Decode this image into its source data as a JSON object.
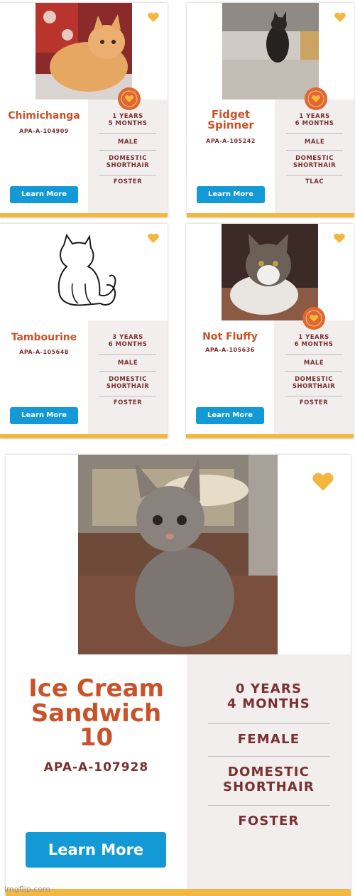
{
  "cats": [
    {
      "name": "Chimichanga",
      "id": "APA-A-104909",
      "age_line1": "1 YEARS",
      "age_line2": "5 MONTHS",
      "sex": "MALE",
      "breed_line1": "DOMESTIC",
      "breed_line2": "SHORTHAIR",
      "placement": "FOSTER",
      "button": "Learn More",
      "badge": "Waived Adoption Fee"
    },
    {
      "name_line1": "Fidget",
      "name_line2": "Spinner",
      "id": "APA-A-105242",
      "age_line1": "1 YEARS",
      "age_line2": "6 MONTHS",
      "sex": "MALE",
      "breed_line1": "DOMESTIC",
      "breed_line2": "SHORTHAIR",
      "placement": "TLAC",
      "button": "Learn More",
      "badge": "Waived Adoption Fee"
    },
    {
      "name": "Tambourine",
      "id": "APA-A-105648",
      "age_line1": "3 YEARS",
      "age_line2": "6 MONTHS",
      "sex": "MALE",
      "breed_line1": "DOMESTIC",
      "breed_line2": "SHORTHAIR",
      "placement": "FOSTER",
      "button": "Learn More"
    },
    {
      "name": "Not Fluffy",
      "id": "APA-A-105636",
      "age_line1": "1 YEARS",
      "age_line2": "6 MONTHS",
      "sex": "MALE",
      "breed_line1": "DOMESTIC",
      "breed_line2": "SHORTHAIR",
      "placement": "FOSTER",
      "button": "Learn More",
      "badge": "Waived Adoption Fee"
    },
    {
      "name_line1": "Ice Cream",
      "name_line2": "Sandwich",
      "name_line3": "10",
      "id": "APA-A-107928",
      "age_line1": "0 YEARS",
      "age_line2": "4 MONTHS",
      "sex": "FEMALE",
      "breed_line1": "DOMESTIC",
      "breed_line2": "SHORTHAIR",
      "placement": "FOSTER",
      "button": "Learn More"
    }
  ],
  "watermark": "imgflip.com",
  "colors": {
    "name": "#c8532a",
    "detail": "#7a3030",
    "button": "#139ad6",
    "accent_bar": "#f3b843",
    "heart": "#f4b63f",
    "side_panel": "#f2eeee"
  }
}
